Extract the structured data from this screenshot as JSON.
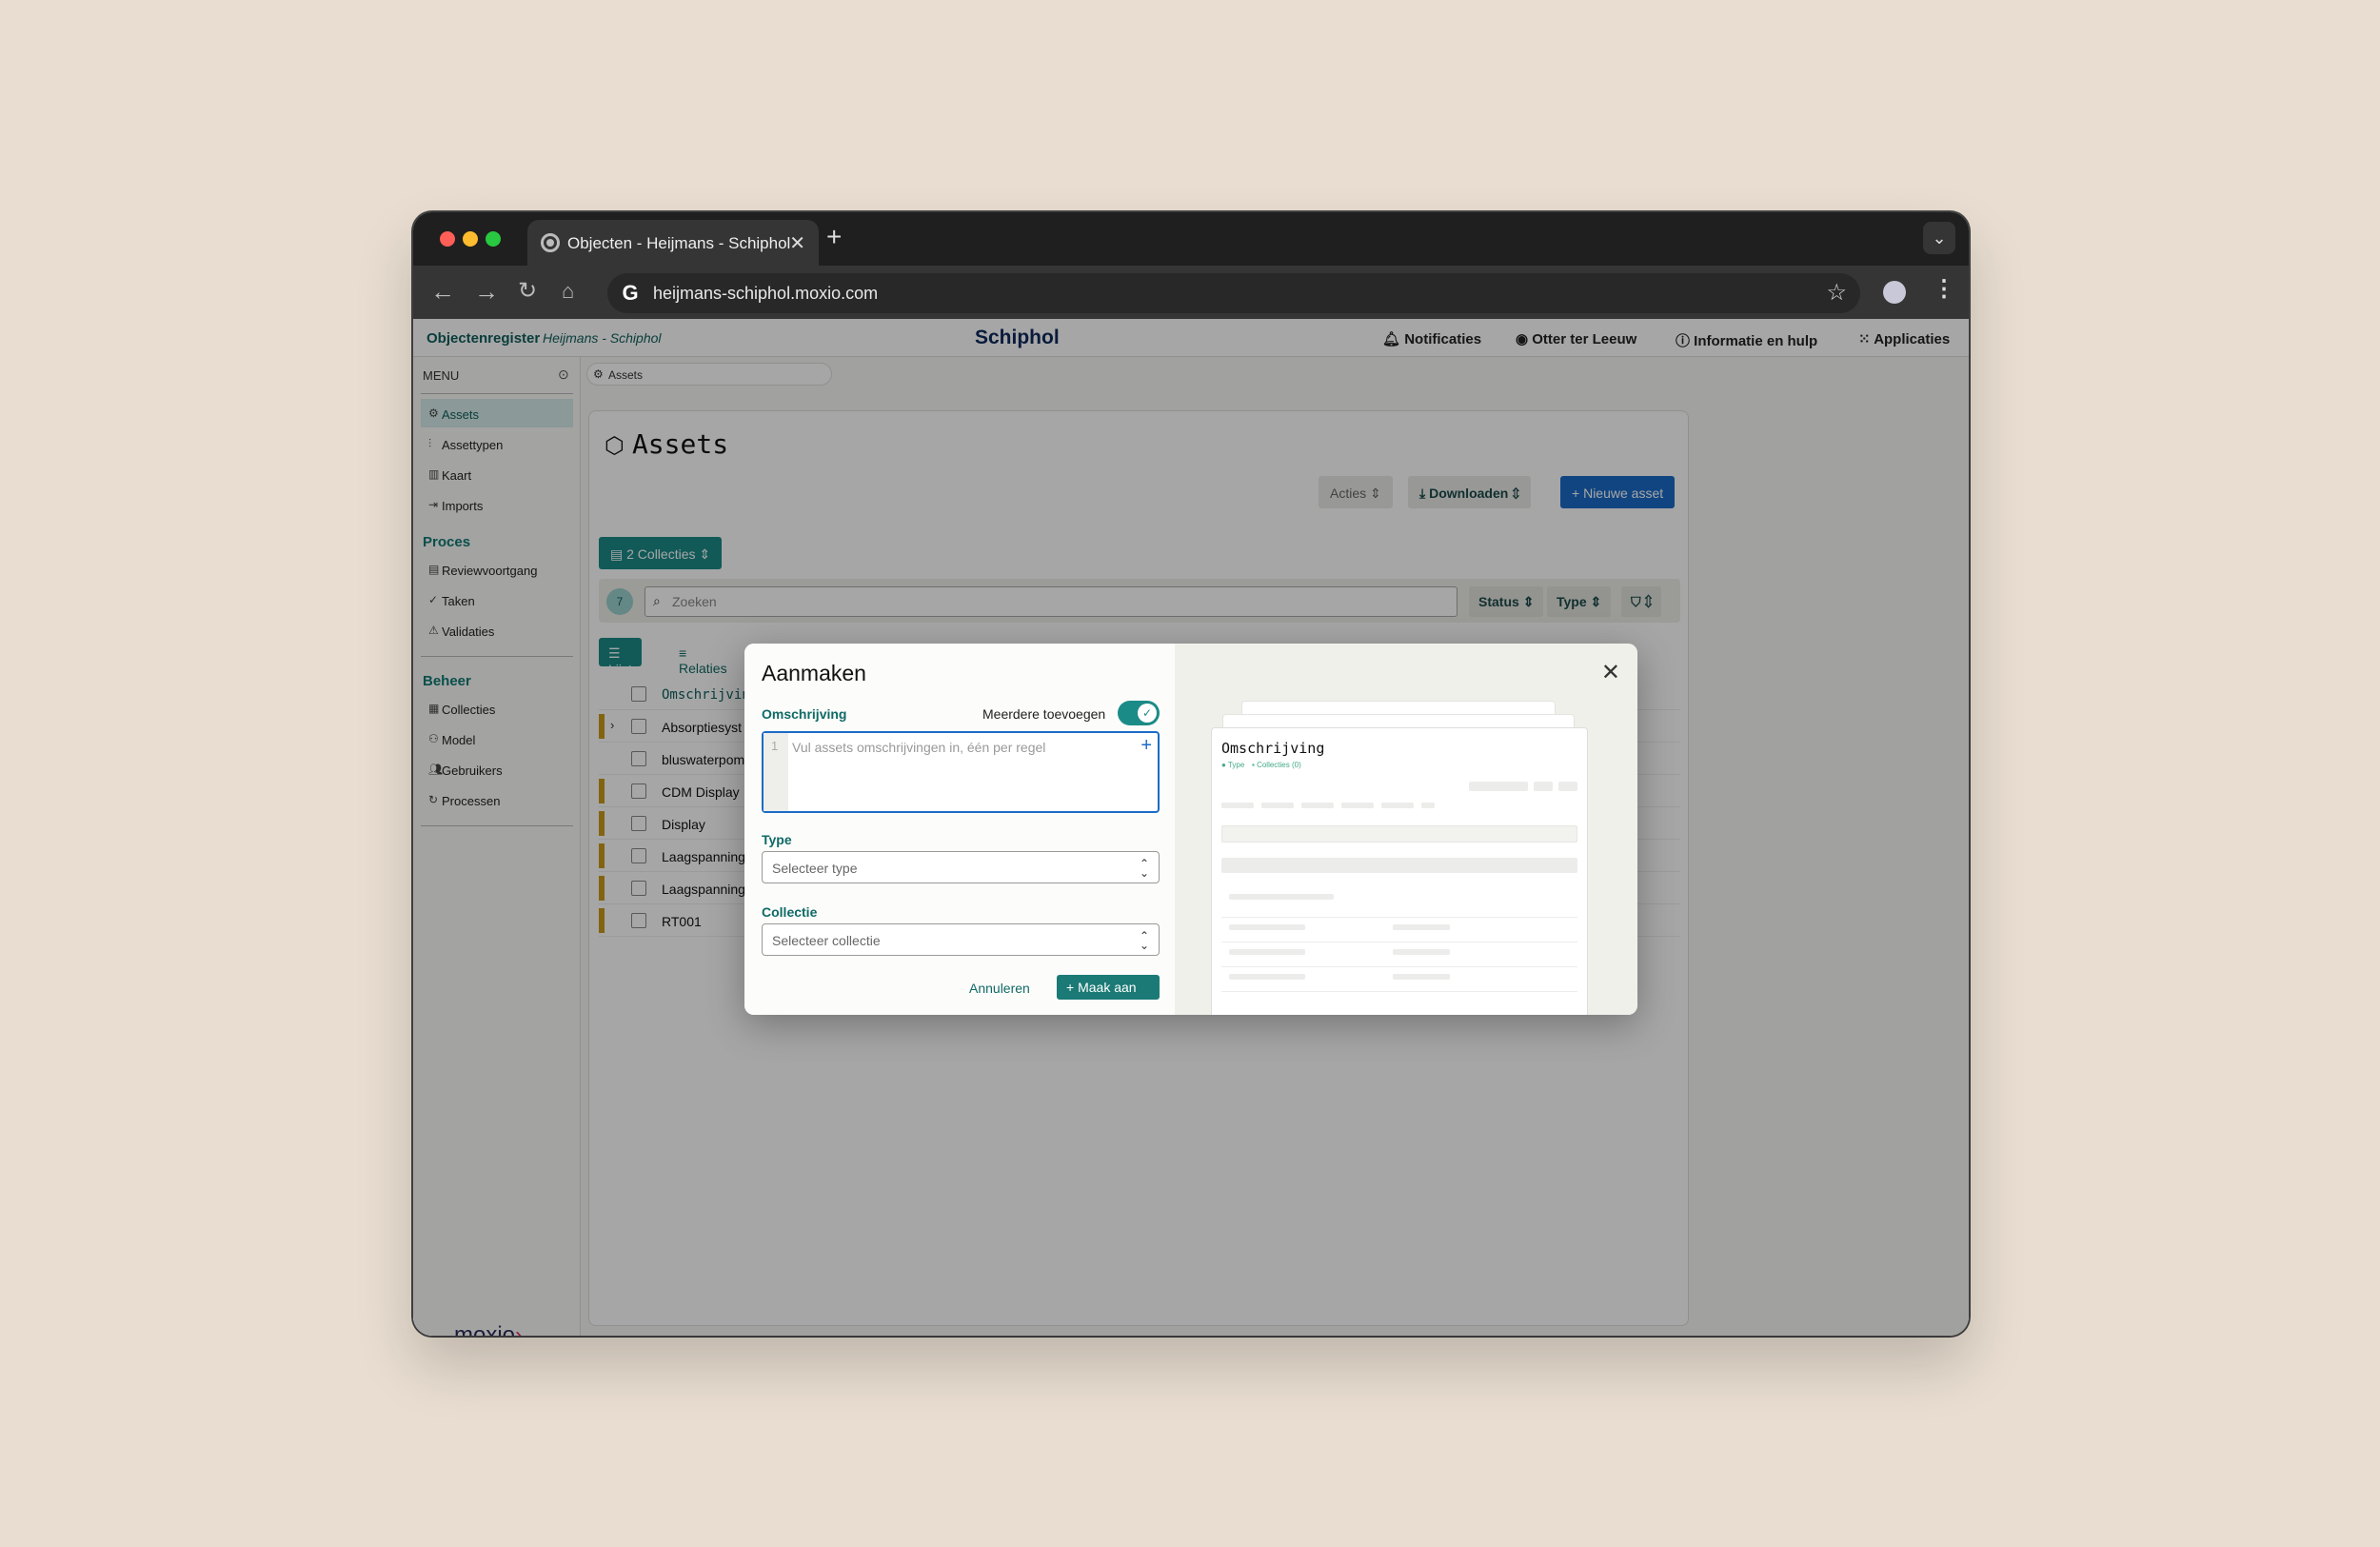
{
  "browser": {
    "tab_title": "Objecten - Heijmans - Schiphol",
    "url": "heijmans-schiphol.moxio.com"
  },
  "topbar": {
    "brand": "Objectenregister",
    "subtitle": "Heijmans - Schiphol",
    "logo": "Schiphol",
    "notifications": "Notificaties",
    "user": "Otter ter Leeuw",
    "help": "Informatie en hulp",
    "apps": "Applicaties"
  },
  "sidebar": {
    "menu_label": "MENU",
    "items": [
      {
        "label": "Assets"
      },
      {
        "label": "Assettypen"
      },
      {
        "label": "Kaart"
      },
      {
        "label": "Imports"
      }
    ],
    "proces_heading": "Proces",
    "proces_items": [
      {
        "label": "Reviewvoortgang"
      },
      {
        "label": "Taken"
      },
      {
        "label": "Validaties"
      }
    ],
    "beheer_heading": "Beheer",
    "beheer_items": [
      {
        "label": "Collecties"
      },
      {
        "label": "Model"
      },
      {
        "label": "Gebruikers"
      },
      {
        "label": "Processen"
      }
    ],
    "footer_logo": "moxio"
  },
  "main": {
    "breadcrumb": "Assets",
    "title": "Assets",
    "actions": "Acties",
    "download": "Downloaden",
    "new_asset": "Nieuwe asset",
    "collections": "2 Collecties",
    "count": "7",
    "search_placeholder": "Zoeken",
    "status": "Status",
    "type": "Type",
    "view_list": "Lijst",
    "view_relations": "Relaties",
    "rows": [
      {
        "text": "Omschrijving"
      },
      {
        "text": "Absorptiesyst"
      },
      {
        "text": "bluswaterpom"
      },
      {
        "text": "CDM Display"
      },
      {
        "text": "Display"
      },
      {
        "text": "Laagspanning"
      },
      {
        "text": "Laagspanning"
      },
      {
        "text": "RT001"
      }
    ]
  },
  "modal": {
    "title": "Aanmaken",
    "omschrijving_label": "Omschrijving",
    "multiple_label": "Meerdere toevoegen",
    "line_number": "1",
    "editor_placeholder": "Vul assets omschrijvingen in, één per regel",
    "type_label": "Type",
    "type_placeholder": "Selecteer type",
    "collectie_label": "Collectie",
    "collectie_placeholder": "Selecteer collectie",
    "cancel": "Annuleren",
    "create": "Maak aan",
    "preview": {
      "title": "Omschrijving",
      "type_tag": "Type",
      "collections_tag": "Collecties (0)"
    }
  },
  "colors": {
    "accent": "#1b8b88",
    "primary_blue": "#1b6bc7",
    "brand_teal": "#0f5f5c",
    "flag": "#c89a1a"
  }
}
